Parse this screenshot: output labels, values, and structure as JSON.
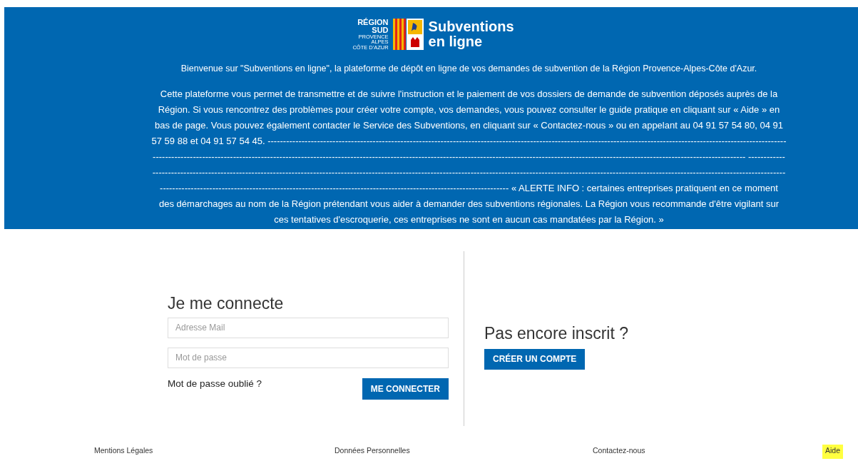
{
  "header": {
    "logo": {
      "region_line1": "RÉGION",
      "region_line2": "SUD",
      "sub_lines": [
        "PROVENCE",
        "ALPES",
        "CÔTE D'AZUR"
      ],
      "title_line1": "Subventions",
      "title_line2": "en ligne"
    },
    "paragraphs": [
      "Bienvenue sur \"Subventions en ligne\", la plateforme de dépôt en ligne de vos demandes de subvention de la Région Provence-Alpes-Côte d'Azur.",
      {
        "info_text": "Cette plateforme vous permet de transmettre et de suivre l'instruction et le paiement de vos dossiers de demande de subvention déposés auprès de la Région. Si vous rencontrez des problèmes pour créer votre compte, vos demandes, vous pouvez consulter le guide pratique en cliquant sur « Aide » en bas de page. Vous pouvez également contacter le Service des Subventions, en cliquant sur « Contactez-nous » ou en appelant au 04 91 57 54 80, 04 91 57 59 88 et 04 91 57 54 45.",
        "separators": [
          "------------------------------------------------------------------------------------------------------------------------------------------------------------------------------------------------------------------------------------------------------------------------------------------------------------------------------------------------------------------------",
          "------------------------------------------------------------------------------------------------------------------------------------------------------------------------------------------------------------------------------------------------------------------------------------------------------------------------------------------"
        ],
        "alert_text": "« ALERTE INFO : certaines entreprises pratiquent en ce moment des démarchages au nom de la Région prétendant vous aider à demander des subventions régionales. La Région vous recommande d'être vigilant sur ces tentatives d'escroquerie, ces entreprises ne sont en aucun cas mandatées par la Région. »"
      }
    ]
  },
  "login": {
    "title": "Je me connecte",
    "email": {
      "placeholder": "Adresse Mail"
    },
    "password": {
      "placeholder": "Mot de passe"
    },
    "forgot_link": "Mot de passe oublié ?",
    "submit_button": "ME CONNECTER"
  },
  "signup": {
    "title": "Pas encore inscrit ?",
    "button": "CRÉER UN COMPTE"
  },
  "footer": [
    {
      "label": "Mentions Légales",
      "highlighted": false
    },
    {
      "label": "Données Personnelles",
      "highlighted": false
    },
    {
      "label": "Contactez-nous",
      "highlighted": false
    },
    {
      "label": "Aide",
      "highlighted": true
    }
  ]
}
